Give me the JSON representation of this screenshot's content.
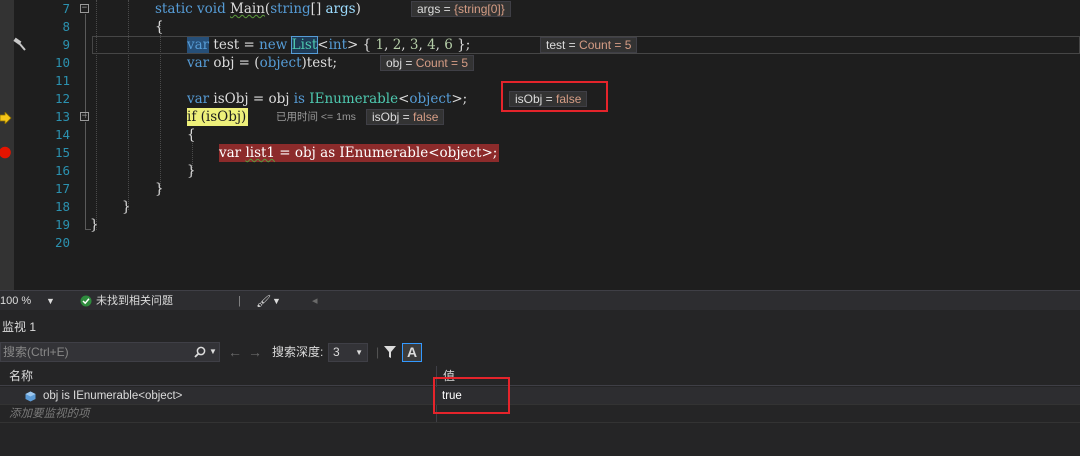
{
  "editor": {
    "lines": {
      "l7": {
        "num": "7",
        "kw1": "static",
        "kw2": "void",
        "method": "Main",
        "p1": "(",
        "ty": "string",
        "p2": "[] ",
        "param": "args",
        "p3": ")"
      },
      "l8": {
        "num": "8",
        "text": "{"
      },
      "l9": {
        "num": "9",
        "kw": "var",
        "a": " test = ",
        "kw2": "new",
        "sp": " ",
        "ty1": "List",
        "lt": "<",
        "kw3": "int",
        "gt": "> { ",
        "n1": "1",
        "c1": ", ",
        "n2": "2",
        "c2": ", ",
        "n3": "3",
        "c3": ", ",
        "n4": "4",
        "c4": ", ",
        "n5": "6",
        "end": " };"
      },
      "l10": {
        "num": "10",
        "kw": "var",
        "a": " obj = (",
        "kw2": "object",
        "b": ")test;"
      },
      "l11": {
        "num": "11"
      },
      "l12": {
        "num": "12",
        "kw": "var",
        "a": " isObj = obj ",
        "kw2": "is",
        "sp": " ",
        "ty": "IEnumerable",
        "lt": "<",
        "kw3": "object",
        "gt": ">;"
      },
      "l13": {
        "num": "13",
        "kw": "if",
        "rest": " (isObj)"
      },
      "l14": {
        "num": "14",
        "text": "{"
      },
      "l15": {
        "num": "15",
        "kw": "var",
        "sp": " ",
        "name": "list1",
        "rest": " = obj as IEnumerable<object>;"
      },
      "l16": {
        "num": "16",
        "text": "}"
      },
      "l17": {
        "num": "17",
        "text": "}"
      },
      "l18": {
        "num": "18",
        "text": "}"
      },
      "l19": {
        "num": "19",
        "text": "}"
      },
      "l20": {
        "num": "20"
      }
    },
    "datatips": {
      "args": {
        "name": "args",
        "eq": " = ",
        "value": "{string[0]}"
      },
      "test": {
        "name": "test",
        "eq": " = ",
        "value": "Count = 5"
      },
      "obj": {
        "name": "obj",
        "eq": " = ",
        "value": "Count = 5"
      },
      "isObj12": {
        "name": "isObj",
        "eq": " = ",
        "value": "false"
      },
      "isObj13": {
        "name": "isObj",
        "eq": " = ",
        "value": "false"
      }
    },
    "perf_tip": "已用时间 <= 1ms",
    "colors": {
      "breakpoint": "#e51400",
      "exec_arrow": "#f5c518",
      "highlight_box": "#e5242b"
    }
  },
  "status": {
    "zoom": "100 %",
    "issues": "未找到相关问题"
  },
  "watch": {
    "title": "监视 1",
    "search_placeholder": "搜索(Ctrl+E)",
    "depth_label": "搜索深度:",
    "depth_value": "3",
    "col_name": "名称",
    "col_value": "值",
    "rows": [
      {
        "name": "obj is IEnumerable<object>",
        "value": "true"
      }
    ],
    "add_placeholder": "添加要监视的项"
  }
}
